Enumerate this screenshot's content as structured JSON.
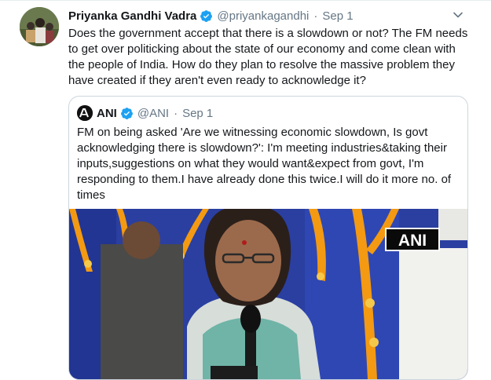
{
  "tweet": {
    "author_name": "Priyanka Gandhi Vadra",
    "handle": "@priyankagandhi",
    "separator": "·",
    "date": "Sep 1",
    "text": "Does the government accept that there is a slowdown or not? The FM needs\nto get over politicking about the state of our economy and come clean with\nthe people of India. How do they plan to resolve the massive problem they\nhave created if they aren't even ready to acknowledge it?"
  },
  "quoted": {
    "author_name": "ANI",
    "handle": "@ANI",
    "separator": "·",
    "date": "Sep 1",
    "text": "FM on being asked 'Are we witnessing economic slowdown, Is govt\nacknowledging there is slowdown?': I'm meeting industries&taking their\ninputs,suggestions on what they would want&expect from govt, I'm\nresponding to them.I have already done this twice.I will do it more no. of\ntimes",
    "media_watermark": "ANI"
  },
  "icons": {
    "verified": "verified-badge-icon",
    "caret": "chevron-down-icon"
  },
  "colors": {
    "verified_blue": "#1da1f2",
    "secondary_text": "#657786",
    "border": "#ccd6dd"
  }
}
